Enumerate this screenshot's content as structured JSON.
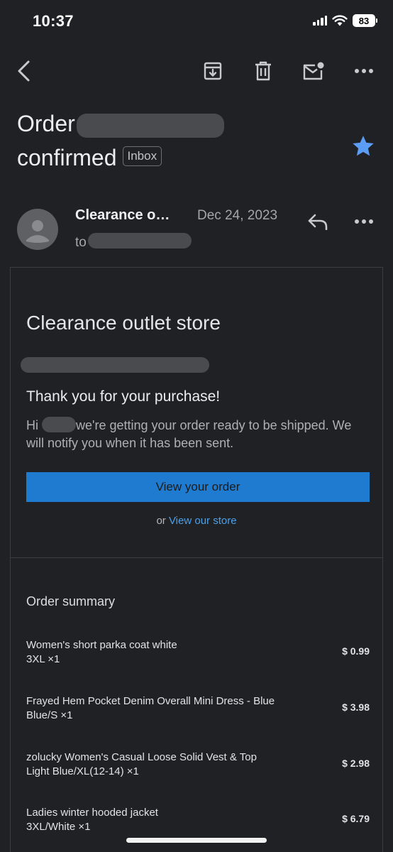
{
  "status": {
    "time": "10:37",
    "battery": "83"
  },
  "toolbar": {
    "back": "back-arrow",
    "archive": "archive-icon",
    "delete": "trash-icon",
    "unread": "mark-unread-icon",
    "more": "more-icon"
  },
  "subject": {
    "line1": "Order",
    "line2": "confirmed",
    "label": "Inbox",
    "starred_color": "#5b9cf5"
  },
  "message": {
    "sender": "Clearance o…",
    "date": "Dec 24, 2023",
    "to_prefix": "to"
  },
  "email": {
    "store_name": "Clearance outlet store",
    "thanks": "Thank you for your purchase!",
    "greeting": "Hi",
    "body_rest": "we're getting your order ready to be shipped. We will notify you when it has been sent.",
    "button": "View your order",
    "or": "or",
    "store_link": "View our store",
    "accent": "#1f7bd0"
  },
  "summary": {
    "title": "Order summary",
    "items": [
      {
        "name": "Women's short parka coat white",
        "variant": "3XL ×1",
        "price": "$ 0.99"
      },
      {
        "name": "Frayed Hem Pocket Denim Overall Mini Dress - Blue",
        "variant": "Blue/S ×1",
        "price": "$ 3.98"
      },
      {
        "name": "zolucky Women's Casual Loose Solid Vest & Top",
        "variant": "Light Blue/XL(12-14) ×1",
        "price": "$ 2.98"
      },
      {
        "name": "Ladies winter hooded jacket",
        "variant": "3XL/White ×1",
        "price": "$ 6.79"
      }
    ]
  }
}
